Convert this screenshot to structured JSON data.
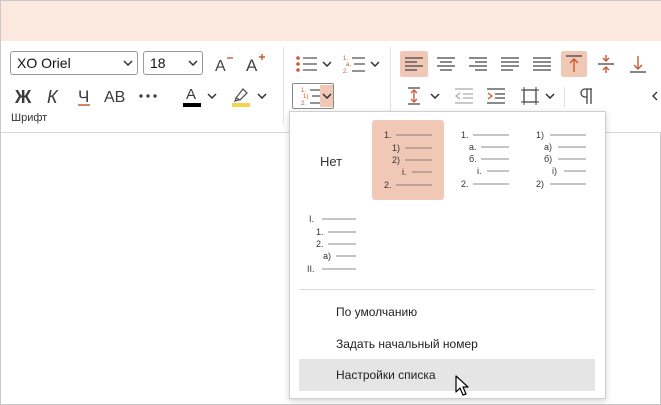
{
  "font_group": {
    "font_name": "XO Oriel",
    "font_size": "18",
    "label": "Шрифт",
    "font_color": "#000000",
    "highlight_color": "#f5d34a"
  },
  "list_menu": {
    "none_label": "Нет",
    "styles": [
      {
        "id": "numbered-mixed",
        "selected": true,
        "lines": [
          "1.",
          "1)",
          "2)",
          "i.",
          "2."
        ]
      },
      {
        "id": "numbered-alpha",
        "selected": false,
        "lines": [
          "1.",
          "а.",
          "б.",
          "i.",
          "2."
        ]
      },
      {
        "id": "numbered-paren",
        "selected": false,
        "lines": [
          "1)",
          "а)",
          "б)",
          "i)",
          "2)"
        ]
      },
      {
        "id": "roman-mixed",
        "selected": false,
        "lines": [
          "I.",
          "1.",
          "2.",
          "а)",
          "II."
        ]
      }
    ],
    "items": [
      {
        "label": "По умолчанию",
        "hover": false
      },
      {
        "label": "Задать начальный номер",
        "hover": false
      },
      {
        "label": "Настройки списка",
        "hover": true
      }
    ]
  },
  "colors": {
    "accent": "#f1c7b5",
    "titlebar": "#fbe8df",
    "icon_accent": "#c85a2e"
  }
}
